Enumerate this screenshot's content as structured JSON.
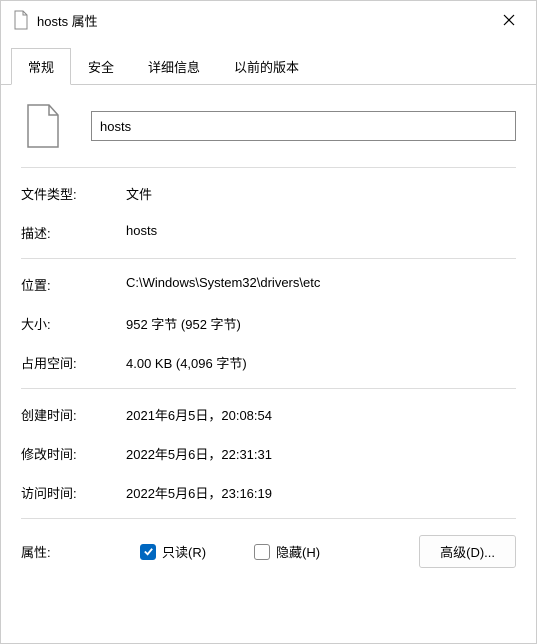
{
  "titlebar": {
    "title": "hosts 属性"
  },
  "tabs": {
    "general": "常规",
    "security": "安全",
    "details": "详细信息",
    "previous": "以前的版本"
  },
  "file": {
    "name": "hosts"
  },
  "rows": {
    "type_label": "文件类型:",
    "type_value": "文件",
    "desc_label": "描述:",
    "desc_value": "hosts",
    "location_label": "位置:",
    "location_value": "C:\\Windows\\System32\\drivers\\etc",
    "size_label": "大小:",
    "size_value": "952 字节 (952 字节)",
    "disk_label": "占用空间:",
    "disk_value": "4.00 KB (4,096 字节)",
    "created_label": "创建时间:",
    "created_value": "2021年6月5日，20:08:54",
    "modified_label": "修改时间:",
    "modified_value": "2022年5月6日，22:31:31",
    "accessed_label": "访问时间:",
    "accessed_value": "2022年5月6日，23:16:19",
    "attrs_label": "属性:"
  },
  "checkboxes": {
    "readonly_label": "只读(R)",
    "hidden_label": "隐藏(H)"
  },
  "buttons": {
    "advanced": "高级(D)..."
  }
}
